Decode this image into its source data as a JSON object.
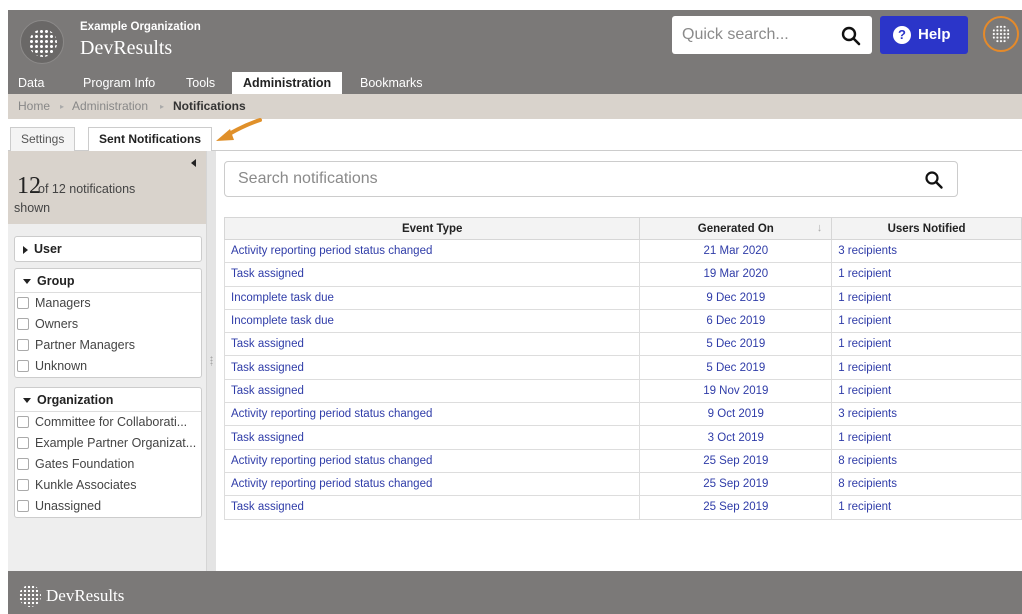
{
  "header": {
    "org_name": "Example Organization",
    "app_name": "DevResults",
    "search_placeholder": "Quick search...",
    "help_label": "Help",
    "help_icon": "?"
  },
  "nav": {
    "items": [
      {
        "label": "Data"
      },
      {
        "label": "Program Info"
      },
      {
        "label": "Tools"
      },
      {
        "label": "Administration",
        "active": true
      },
      {
        "label": "Bookmarks"
      }
    ]
  },
  "breadcrumb": {
    "items": [
      "Home",
      "Administration",
      "Notifications"
    ],
    "separator": "▸"
  },
  "subtabs": {
    "items": [
      {
        "label": "Settings"
      },
      {
        "label": "Sent Notifications",
        "active": true
      }
    ]
  },
  "sidebar": {
    "count": "12",
    "count_text": "of 12 notifications",
    "shown_text": "shown",
    "filters": [
      {
        "title": "User",
        "expanded": false,
        "options": []
      },
      {
        "title": "Group",
        "expanded": true,
        "options": [
          "Managers",
          "Owners",
          "Partner Managers",
          "Unknown"
        ]
      },
      {
        "title": "Organization",
        "expanded": true,
        "options": [
          "Committee for Collaborati...",
          "Example Partner Organizat...",
          "Gates Foundation",
          "Kunkle Associates",
          "Unassigned"
        ]
      }
    ]
  },
  "main": {
    "search_placeholder": "Search notifications",
    "columns": [
      "Event Type",
      "Generated On",
      "Users Notified"
    ],
    "sort_indicator": "↓",
    "rows": [
      [
        "Activity reporting period status changed",
        "21 Mar 2020",
        "3 recipients"
      ],
      [
        "Task assigned",
        "19 Mar 2020",
        "1 recipient"
      ],
      [
        "Incomplete task due",
        "9 Dec 2019",
        "1 recipient"
      ],
      [
        "Incomplete task due",
        "6 Dec 2019",
        "1 recipient"
      ],
      [
        "Task assigned",
        "5 Dec 2019",
        "1 recipient"
      ],
      [
        "Task assigned",
        "5 Dec 2019",
        "1 recipient"
      ],
      [
        "Task assigned",
        "19 Nov 2019",
        "1 recipient"
      ],
      [
        "Activity reporting period status changed",
        "9 Oct 2019",
        "3 recipients"
      ],
      [
        "Task assigned",
        "3 Oct 2019",
        "1 recipient"
      ],
      [
        "Activity reporting period status changed",
        "25 Sep 2019",
        "8 recipients"
      ],
      [
        "Activity reporting period status changed",
        "25 Sep 2019",
        "8 recipients"
      ],
      [
        "Task assigned",
        "25 Sep 2019",
        "1 recipient"
      ]
    ]
  },
  "footer": {
    "name": "DevResults"
  },
  "colors": {
    "header_bg": "#7b7978",
    "help_button": "#2b35c9",
    "link": "#2f3ca8",
    "annotation_arrow": "#e0902a",
    "breadcrumb_bg": "#d9d3cc"
  }
}
